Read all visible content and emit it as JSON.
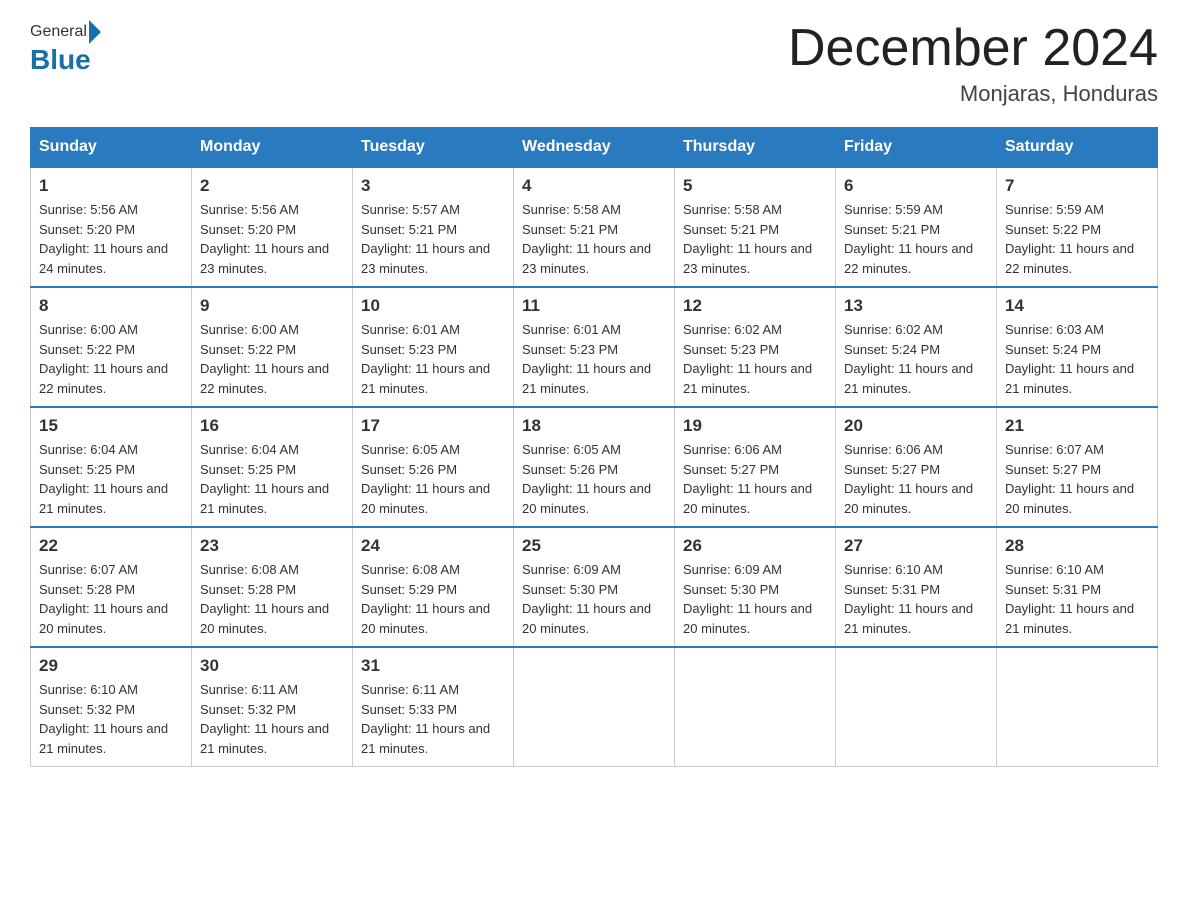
{
  "header": {
    "logo_general": "General",
    "logo_blue": "Blue",
    "month_title": "December 2024",
    "location": "Monjaras, Honduras"
  },
  "days_of_week": [
    "Sunday",
    "Monday",
    "Tuesday",
    "Wednesday",
    "Thursday",
    "Friday",
    "Saturday"
  ],
  "weeks": [
    [
      {
        "day": "1",
        "sunrise": "5:56 AM",
        "sunset": "5:20 PM",
        "daylight": "11 hours and 24 minutes."
      },
      {
        "day": "2",
        "sunrise": "5:56 AM",
        "sunset": "5:20 PM",
        "daylight": "11 hours and 23 minutes."
      },
      {
        "day": "3",
        "sunrise": "5:57 AM",
        "sunset": "5:21 PM",
        "daylight": "11 hours and 23 minutes."
      },
      {
        "day": "4",
        "sunrise": "5:58 AM",
        "sunset": "5:21 PM",
        "daylight": "11 hours and 23 minutes."
      },
      {
        "day": "5",
        "sunrise": "5:58 AM",
        "sunset": "5:21 PM",
        "daylight": "11 hours and 23 minutes."
      },
      {
        "day": "6",
        "sunrise": "5:59 AM",
        "sunset": "5:21 PM",
        "daylight": "11 hours and 22 minutes."
      },
      {
        "day": "7",
        "sunrise": "5:59 AM",
        "sunset": "5:22 PM",
        "daylight": "11 hours and 22 minutes."
      }
    ],
    [
      {
        "day": "8",
        "sunrise": "6:00 AM",
        "sunset": "5:22 PM",
        "daylight": "11 hours and 22 minutes."
      },
      {
        "day": "9",
        "sunrise": "6:00 AM",
        "sunset": "5:22 PM",
        "daylight": "11 hours and 22 minutes."
      },
      {
        "day": "10",
        "sunrise": "6:01 AM",
        "sunset": "5:23 PM",
        "daylight": "11 hours and 21 minutes."
      },
      {
        "day": "11",
        "sunrise": "6:01 AM",
        "sunset": "5:23 PM",
        "daylight": "11 hours and 21 minutes."
      },
      {
        "day": "12",
        "sunrise": "6:02 AM",
        "sunset": "5:23 PM",
        "daylight": "11 hours and 21 minutes."
      },
      {
        "day": "13",
        "sunrise": "6:02 AM",
        "sunset": "5:24 PM",
        "daylight": "11 hours and 21 minutes."
      },
      {
        "day": "14",
        "sunrise": "6:03 AM",
        "sunset": "5:24 PM",
        "daylight": "11 hours and 21 minutes."
      }
    ],
    [
      {
        "day": "15",
        "sunrise": "6:04 AM",
        "sunset": "5:25 PM",
        "daylight": "11 hours and 21 minutes."
      },
      {
        "day": "16",
        "sunrise": "6:04 AM",
        "sunset": "5:25 PM",
        "daylight": "11 hours and 21 minutes."
      },
      {
        "day": "17",
        "sunrise": "6:05 AM",
        "sunset": "5:26 PM",
        "daylight": "11 hours and 20 minutes."
      },
      {
        "day": "18",
        "sunrise": "6:05 AM",
        "sunset": "5:26 PM",
        "daylight": "11 hours and 20 minutes."
      },
      {
        "day": "19",
        "sunrise": "6:06 AM",
        "sunset": "5:27 PM",
        "daylight": "11 hours and 20 minutes."
      },
      {
        "day": "20",
        "sunrise": "6:06 AM",
        "sunset": "5:27 PM",
        "daylight": "11 hours and 20 minutes."
      },
      {
        "day": "21",
        "sunrise": "6:07 AM",
        "sunset": "5:27 PM",
        "daylight": "11 hours and 20 minutes."
      }
    ],
    [
      {
        "day": "22",
        "sunrise": "6:07 AM",
        "sunset": "5:28 PM",
        "daylight": "11 hours and 20 minutes."
      },
      {
        "day": "23",
        "sunrise": "6:08 AM",
        "sunset": "5:28 PM",
        "daylight": "11 hours and 20 minutes."
      },
      {
        "day": "24",
        "sunrise": "6:08 AM",
        "sunset": "5:29 PM",
        "daylight": "11 hours and 20 minutes."
      },
      {
        "day": "25",
        "sunrise": "6:09 AM",
        "sunset": "5:30 PM",
        "daylight": "11 hours and 20 minutes."
      },
      {
        "day": "26",
        "sunrise": "6:09 AM",
        "sunset": "5:30 PM",
        "daylight": "11 hours and 20 minutes."
      },
      {
        "day": "27",
        "sunrise": "6:10 AM",
        "sunset": "5:31 PM",
        "daylight": "11 hours and 21 minutes."
      },
      {
        "day": "28",
        "sunrise": "6:10 AM",
        "sunset": "5:31 PM",
        "daylight": "11 hours and 21 minutes."
      }
    ],
    [
      {
        "day": "29",
        "sunrise": "6:10 AM",
        "sunset": "5:32 PM",
        "daylight": "11 hours and 21 minutes."
      },
      {
        "day": "30",
        "sunrise": "6:11 AM",
        "sunset": "5:32 PM",
        "daylight": "11 hours and 21 minutes."
      },
      {
        "day": "31",
        "sunrise": "6:11 AM",
        "sunset": "5:33 PM",
        "daylight": "11 hours and 21 minutes."
      },
      null,
      null,
      null,
      null
    ]
  ]
}
